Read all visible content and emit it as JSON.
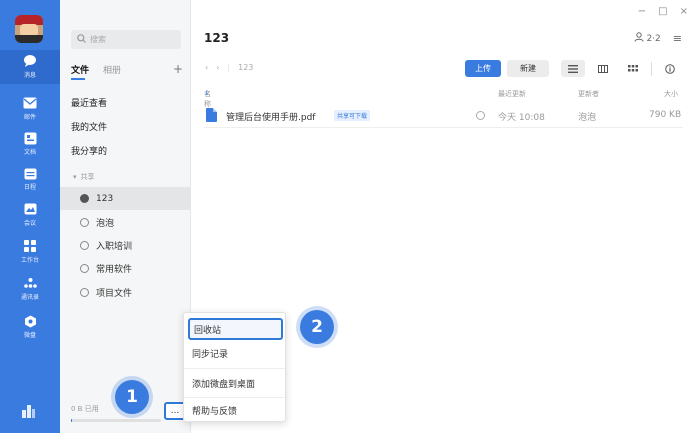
{
  "rail": {
    "items": [
      {
        "label": "消息",
        "icon": "chat-icon"
      },
      {
        "label": "邮件",
        "icon": "mail-icon"
      },
      {
        "label": "文档",
        "icon": "doc-icon"
      },
      {
        "label": "日程",
        "icon": "calendar-icon"
      },
      {
        "label": "会议",
        "icon": "meeting-icon"
      },
      {
        "label": "工作台",
        "icon": "workbench-icon"
      },
      {
        "label": "通讯录",
        "icon": "contacts-icon"
      },
      {
        "label": "微盘",
        "icon": "drive-icon"
      }
    ],
    "bottom_icon": "app-logo-icon"
  },
  "sidebar": {
    "search_placeholder": "搜索",
    "tab_files": "文件",
    "tab_album": "相册",
    "plus": "+",
    "nav": [
      "最近查看",
      "我的文件",
      "我分享的"
    ],
    "share_header": "共享",
    "shares": [
      "123",
      "泡泡",
      "入职培训",
      "常用软件",
      "项目文件"
    ],
    "usage": "0 B 已用",
    "usage_fraction": 0.01,
    "more": "..."
  },
  "window": {
    "minimize": "−",
    "maximize": "□",
    "close": "×"
  },
  "main": {
    "title": "123",
    "members": "2·2",
    "menu_icon": "≡",
    "breadcrumb": [
      "123"
    ],
    "upload": "上传",
    "new": "新建",
    "columns": {
      "name": "名称",
      "modified": "最近更新",
      "updater": "更新者",
      "size": "大小"
    },
    "rows": [
      {
        "name": "管理后台使用手册.pdf",
        "tag": "共享可下载",
        "modified": "今天 10:08",
        "updater": "泡泡",
        "size": "790 KB"
      }
    ]
  },
  "menu": {
    "items": [
      "回收站",
      "同步记录",
      "添加微盘到桌面",
      "帮助与反馈"
    ]
  },
  "steps": [
    "1",
    "2"
  ]
}
